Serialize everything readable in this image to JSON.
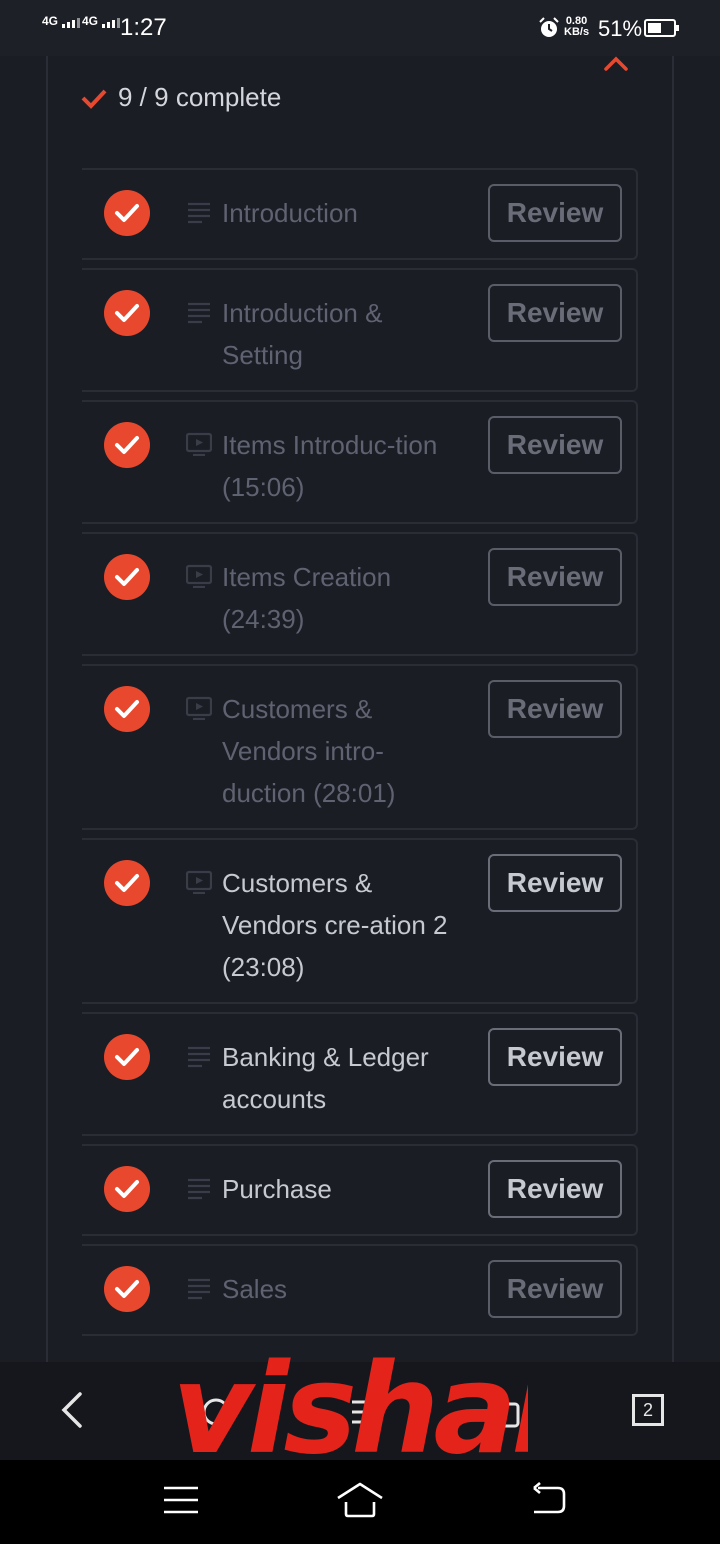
{
  "status_bar": {
    "network_1": "4G",
    "network_2": "4G",
    "time": "1:27",
    "speed_value": "0.80",
    "speed_unit": "KB/s",
    "battery_percent": "51%",
    "battery_level": 0.51
  },
  "section": {
    "progress_text": "9 / 9 complete",
    "accent_color": "#e8492e"
  },
  "lessons": [
    {
      "title": "Introduction",
      "type": "text",
      "review_label": "Review"
    },
    {
      "title": "Introduction & Setting",
      "type": "text",
      "review_label": "Review"
    },
    {
      "title": "Items Introduc-tion (15:06)",
      "type": "video",
      "review_label": "Review"
    },
    {
      "title": "Items Creation (24:39)",
      "type": "video",
      "review_label": "Review"
    },
    {
      "title": "Customers & Vendors intro-duction (28:01)",
      "type": "video",
      "review_label": "Review"
    },
    {
      "title": "Customers & Vendors cre-ation 2 (23:08)",
      "type": "video",
      "review_label": "Review"
    },
    {
      "title": "Banking & Ledger accounts",
      "type": "text",
      "review_label": "Review"
    },
    {
      "title": "Purchase",
      "type": "text",
      "review_label": "Review"
    },
    {
      "title": "Sales",
      "type": "text",
      "review_label": "Review"
    }
  ],
  "browser_bar": {
    "tab_count": "2",
    "icons": [
      "back-icon",
      "home-icon",
      "menu-icon",
      "bag-icon",
      "tabs-icon"
    ]
  },
  "system_nav": {
    "icons": [
      "menu-icon",
      "home-icon",
      "back-icon"
    ]
  },
  "watermark": {
    "text": "vishal"
  }
}
